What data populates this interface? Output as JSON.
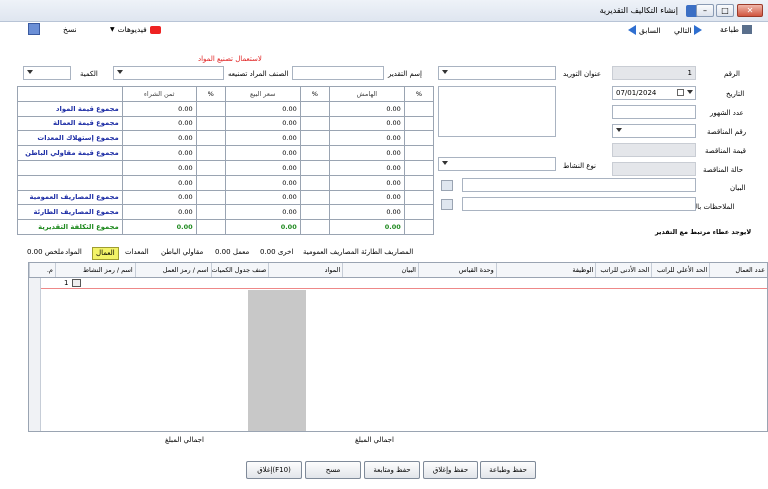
{
  "window": {
    "title": "إنشاء التكاليف التقديرية"
  },
  "toolbar": {
    "print": "طباعة",
    "next": "التالي",
    "previous": "السابق",
    "videos": "فيديوهات",
    "copy": "نسخ"
  },
  "form": {
    "number_label": "الرقم",
    "number_value": "1",
    "supplier_address_label": "عنوان التوريد",
    "date_label": "التاريخ",
    "date_value": "07/01/2024",
    "months_label": "عدد الشهور",
    "tender_number_label": "رقم المناقصة",
    "tender_value_label": "قيمة المناقصة",
    "tender_status_label": "حالة المناقصة",
    "activity_type_label": "نوع النشاط",
    "statement_label": "البيان",
    "notes_arabic_label": "الملاحظات بالعربي",
    "estimate_name_label": "إسم التقدير",
    "item_to_manufacture_label": "الصنف المراد تصنيعه",
    "quantity_label": "الكمية",
    "red_note": "لاستعمال تصنيع المواد",
    "no_tender_note": "لايوجد عطاء مرتبط مع التقدير"
  },
  "summary": {
    "headers": [
      "%",
      "الهامش",
      "%",
      "سعر البيع",
      "%",
      "ثمن الشراء"
    ],
    "rows": [
      {
        "label": "مجموع قيمة المواد",
        "margin": "0.00",
        "price": "0.00",
        "cost": "0.00",
        "style": "blue"
      },
      {
        "label": "مجموع قيمة العمالة",
        "margin": "0.00",
        "price": "0.00",
        "cost": "0.00",
        "style": "blue"
      },
      {
        "label": "مجموع إستهلاك المعدات",
        "margin": "0.00",
        "price": "0.00",
        "cost": "0.00",
        "style": "blue"
      },
      {
        "label": "مجموع قيمة مقاولي الباطن",
        "margin": "0.00",
        "price": "0.00",
        "cost": "0.00",
        "style": "blue"
      },
      {
        "label": "",
        "margin": "0.00",
        "price": "0.00",
        "cost": "0.00",
        "style": "blue"
      },
      {
        "label": "",
        "margin": "0.00",
        "price": "0.00",
        "cost": "0.00",
        "style": "blue"
      },
      {
        "label": "مجموع المصاريف العمومية",
        "margin": "0.00",
        "price": "0.00",
        "cost": "0.00",
        "style": "blue"
      },
      {
        "label": "مجموع المصاريف الطارئة",
        "margin": "0.00",
        "price": "0.00",
        "cost": "0.00",
        "style": "blue"
      },
      {
        "label": "مجموع التكلفة التقديرية",
        "margin": "0.00",
        "price": "0.00",
        "cost": "0.00",
        "style": "green"
      }
    ]
  },
  "tabs": [
    {
      "label": "المصاريف الطارئة"
    },
    {
      "label": "المصاريف العمومية"
    },
    {
      "label": "اخرى 0.00"
    },
    {
      "label": "معمل 0.00"
    },
    {
      "label": "مقاولي الباطن"
    },
    {
      "label": "المعدات"
    },
    {
      "label": "العمال"
    },
    {
      "label": "المواد"
    },
    {
      "label": "ملخص 0.00"
    }
  ],
  "grid": {
    "columns": [
      "عدد العمال",
      "الحد الأعلي للراتب",
      "الحد الأدنى للراتب",
      "الوظيفة",
      "وحدة القياس",
      "البيان",
      "المواد",
      "صنف جدول الكميات",
      "اسم / رمز العمل",
      "اسم / رمز النشاط",
      "م."
    ],
    "first_row_number": "1",
    "total_amount_label": "اجمالي المبلغ"
  },
  "buttons": {
    "save_print": "حفظ وطباعة",
    "save_close": "حفظ وإغلاق",
    "save_continue": "حفظ ومتابعة",
    "clear": "مسح",
    "close": "إغلاق(F10)"
  },
  "colors": {
    "blue_label": "#1f2fa6",
    "green_label": "#1f8a1f",
    "red_note": "#e02020",
    "active_tab": "#f3f367"
  }
}
